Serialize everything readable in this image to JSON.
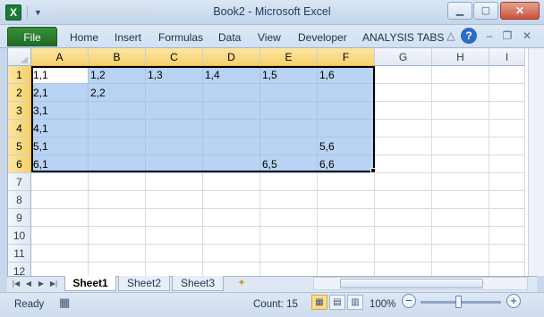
{
  "window": {
    "title": "Book2  -  Microsoft Excel"
  },
  "colors": {
    "file_tab": "#1f6d26",
    "selection": "#b8d3f3",
    "selected_header": "#f7d06b"
  },
  "ribbon": {
    "file_label": "File",
    "tabs": [
      "Home",
      "Insert",
      "Formulas",
      "Data",
      "View",
      "Developer",
      "ANALYSIS TABS"
    ]
  },
  "sheet": {
    "columns": [
      "A",
      "B",
      "C",
      "D",
      "E",
      "F",
      "G",
      "H",
      "I"
    ],
    "rows": [
      "1",
      "2",
      "3",
      "4",
      "5",
      "6",
      "7",
      "8",
      "9",
      "10",
      "11",
      "12"
    ],
    "selected_columns": [
      "A",
      "B",
      "C",
      "D",
      "E",
      "F"
    ],
    "selected_rows": [
      "1",
      "2",
      "3",
      "4",
      "5",
      "6"
    ],
    "active_cell": "A1",
    "cells": {
      "A1": "1,1",
      "B1": "1,2",
      "C1": "1,3",
      "D1": "1,4",
      "E1": "1,5",
      "F1": "1,6",
      "A2": "2,1",
      "B2": "2,2",
      "A3": "3,1",
      "A4": "4,1",
      "A5": "5,1",
      "F5": "5,6",
      "A6": "6,1",
      "E6": "6,5",
      "F6": "6,6"
    }
  },
  "sheet_tabs": [
    "Sheet1",
    "Sheet2",
    "Sheet3"
  ],
  "status": {
    "mode": "Ready",
    "count": "Count: 15",
    "zoom": "100%"
  }
}
